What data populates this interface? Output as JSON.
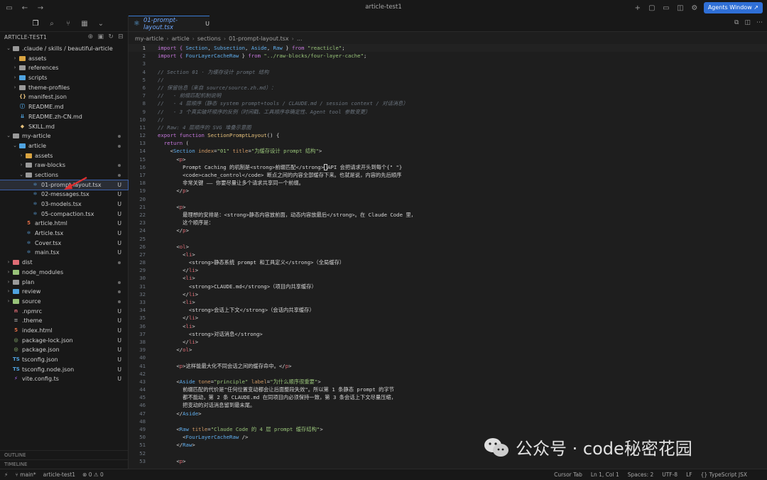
{
  "window": {
    "title": "article-test1",
    "agents_button": "Agents Window ↗"
  },
  "explorer": {
    "header": "ARTICLE-TEST1",
    "tree": [
      {
        "name": ".claude / skills / beautiful-article",
        "depth": 0,
        "type": "folder",
        "open": true,
        "icon": "folder",
        "color": "#9a9a9a",
        "badge": ""
      },
      {
        "name": "assets",
        "depth": 1,
        "type": "folder",
        "open": false,
        "icon": "folder",
        "color": "#d9a441",
        "badge": ""
      },
      {
        "name": "references",
        "depth": 1,
        "type": "folder",
        "open": false,
        "icon": "folder",
        "color": "#9a9a9a",
        "badge": ""
      },
      {
        "name": "scripts",
        "depth": 1,
        "type": "folder",
        "open": false,
        "icon": "folder",
        "color": "#4fa3e0",
        "badge": ""
      },
      {
        "name": "theme-profiles",
        "depth": 1,
        "type": "folder",
        "open": false,
        "icon": "folder",
        "color": "#9a9a9a",
        "badge": ""
      },
      {
        "name": "manifest.json",
        "depth": 1,
        "type": "file",
        "icon": "json",
        "color": "#e5c07b",
        "badge": ""
      },
      {
        "name": "README.md",
        "depth": 1,
        "type": "file",
        "icon": "info",
        "color": "#4fa3e0",
        "badge": ""
      },
      {
        "name": "README.zh-CN.md",
        "depth": 1,
        "type": "file",
        "icon": "md",
        "color": "#4fa3e0",
        "badge": ""
      },
      {
        "name": "SKILL.md",
        "depth": 1,
        "type": "file",
        "icon": "skill",
        "color": "#e5c07b",
        "badge": ""
      },
      {
        "name": "my-article",
        "depth": 0,
        "type": "folder",
        "open": true,
        "icon": "folder",
        "color": "#9a9a9a",
        "badge": "dot"
      },
      {
        "name": "article",
        "depth": 1,
        "type": "folder",
        "open": true,
        "icon": "folder",
        "color": "#4fa3e0",
        "badge": "dot"
      },
      {
        "name": "assets",
        "depth": 2,
        "type": "folder",
        "open": false,
        "icon": "folder",
        "color": "#d9a441",
        "badge": ""
      },
      {
        "name": "raw-blocks",
        "depth": 2,
        "type": "folder",
        "open": false,
        "icon": "folder",
        "color": "#9a9a9a",
        "badge": "dot"
      },
      {
        "name": "sections",
        "depth": 2,
        "type": "folder",
        "open": true,
        "icon": "folder",
        "color": "#9a9a9a",
        "badge": "dot"
      },
      {
        "name": "01-prompt-layout.tsx",
        "depth": 3,
        "type": "file",
        "icon": "react",
        "color": "#61afef",
        "badge": "U",
        "selected": true
      },
      {
        "name": "02-messages.tsx",
        "depth": 3,
        "type": "file",
        "icon": "react",
        "color": "#61afef",
        "badge": "U"
      },
      {
        "name": "03-models.tsx",
        "depth": 3,
        "type": "file",
        "icon": "react",
        "color": "#61afef",
        "badge": "U"
      },
      {
        "name": "05-compaction.tsx",
        "depth": 3,
        "type": "file",
        "icon": "react",
        "color": "#61afef",
        "badge": "U"
      },
      {
        "name": "article.html",
        "depth": 2,
        "type": "file",
        "icon": "html",
        "color": "#e06c45",
        "badge": "U"
      },
      {
        "name": "Article.tsx",
        "depth": 2,
        "type": "file",
        "icon": "react",
        "color": "#61afef",
        "badge": "U"
      },
      {
        "name": "Cover.tsx",
        "depth": 2,
        "type": "file",
        "icon": "react",
        "color": "#61afef",
        "badge": "U"
      },
      {
        "name": "main.tsx",
        "depth": 2,
        "type": "file",
        "icon": "react",
        "color": "#61afef",
        "badge": "U"
      },
      {
        "name": "dist",
        "depth": 0,
        "type": "folder",
        "open": false,
        "icon": "folder",
        "color": "#e06c75",
        "badge": "dot"
      },
      {
        "name": "node_modules",
        "depth": 0,
        "type": "folder",
        "open": false,
        "icon": "folder",
        "color": "#98c379",
        "badge": ""
      },
      {
        "name": "plan",
        "depth": 0,
        "type": "folder",
        "open": false,
        "icon": "folder",
        "color": "#9a9a9a",
        "badge": "dot"
      },
      {
        "name": "review",
        "depth": 0,
        "type": "folder",
        "open": false,
        "icon": "folder",
        "color": "#4fa3e0",
        "badge": "dot"
      },
      {
        "name": "source",
        "depth": 0,
        "type": "folder",
        "open": false,
        "icon": "folder",
        "color": "#98c379",
        "badge": "dot"
      },
      {
        "name": ".npmrc",
        "depth": 0,
        "type": "file",
        "icon": "npm",
        "color": "#e06c75",
        "badge": "U"
      },
      {
        "name": ".theme",
        "depth": 0,
        "type": "file",
        "icon": "lines",
        "color": "#9a9a9a",
        "badge": "U"
      },
      {
        "name": "index.html",
        "depth": 0,
        "type": "file",
        "icon": "html",
        "color": "#e06c45",
        "badge": "U"
      },
      {
        "name": "package-lock.json",
        "depth": 0,
        "type": "file",
        "icon": "pkg",
        "color": "#98c379",
        "badge": "U"
      },
      {
        "name": "package.json",
        "depth": 0,
        "type": "file",
        "icon": "pkg",
        "color": "#98c379",
        "badge": "U"
      },
      {
        "name": "tsconfig.json",
        "depth": 0,
        "type": "file",
        "icon": "ts",
        "color": "#4fa3e0",
        "badge": "U"
      },
      {
        "name": "tsconfig.node.json",
        "depth": 0,
        "type": "file",
        "icon": "ts",
        "color": "#4fa3e0",
        "badge": "U"
      },
      {
        "name": "vite.config.ts",
        "depth": 0,
        "type": "file",
        "icon": "vite",
        "color": "#b36bff",
        "badge": "U"
      }
    ],
    "outline_label": "OUTLINE",
    "timeline_label": "TIMELINE"
  },
  "editor": {
    "tab": {
      "name": "01-prompt-layout.tsx",
      "modified": "U"
    },
    "breadcrumb": [
      "my-article",
      "article",
      "sections",
      "01-prompt-layout.tsx",
      "..."
    ],
    "current_line": 1,
    "lines": [
      [
        [
          "import { ",
          "kw"
        ],
        [
          "Section",
          "comp"
        ],
        [
          ", ",
          "pl"
        ],
        [
          "Subsection",
          "comp"
        ],
        [
          ", ",
          "pl"
        ],
        [
          "Aside",
          "comp"
        ],
        [
          ", ",
          "pl"
        ],
        [
          "Raw",
          "comp"
        ],
        [
          " } ",
          "pl"
        ],
        [
          "from ",
          "kw"
        ],
        [
          "\"reacticle\"",
          "str"
        ],
        [
          ";",
          "pl"
        ]
      ],
      [
        [
          "import { ",
          "kw"
        ],
        [
          "FourLayerCacheRaw",
          "comp"
        ],
        [
          " } ",
          "pl"
        ],
        [
          "from ",
          "kw"
        ],
        [
          "\"../raw-blocks/four-layer-cache\"",
          "str"
        ],
        [
          ";",
          "pl"
        ]
      ],
      [],
      [
        [
          "// Section 01 · 为缓存设计 prompt 结构",
          "cm"
        ]
      ],
      [
        [
          "//",
          "cm"
        ]
      ],
      [
        [
          "// 保留信息（来自 source/source.zh.md）：",
          "cm"
        ]
      ],
      [
        [
          "//   - 前缀匹配机制说明",
          "cm"
        ]
      ],
      [
        [
          "//   - 4 层顺序（静态 system prompt+tools / CLAUDE.md / session context / 对话消息）",
          "cm"
        ]
      ],
      [
        [
          "//   - 3 个真实破坏顺序的反例（时间戳、工具顺序非确定性、Agent tool 参数变更）",
          "cm"
        ]
      ],
      [
        [
          "//",
          "cm"
        ]
      ],
      [
        [
          "// Raw: 4 层顺序的 SVG 堆叠示意图",
          "cm"
        ]
      ],
      [
        [
          "export function ",
          "kw"
        ],
        [
          "SectionPromptLayout",
          "fn"
        ],
        [
          "() {",
          "pl"
        ]
      ],
      [
        [
          "  return ",
          "kw"
        ],
        [
          "(",
          "pl"
        ]
      ],
      [
        [
          "    <",
          "pl"
        ],
        [
          "Section",
          "comp"
        ],
        [
          " index",
          "attr"
        ],
        [
          "=",
          "pl"
        ],
        [
          "\"01\"",
          "str"
        ],
        [
          " title",
          "attr"
        ],
        [
          "=",
          "pl"
        ],
        [
          "\"为缓存设计 prompt 结构\"",
          "str"
        ],
        [
          ">",
          "pl"
        ]
      ],
      [
        [
          "      <",
          "pl"
        ],
        [
          "p",
          "tag"
        ],
        [
          ">",
          "pl"
        ]
      ],
      [
        [
          "        Prompt Caching 的机制是<strong>前缀匹配</strong>",
          "pl"
        ],
        [
          "CURSOR",
          "cur"
        ],
        [
          "API 会把请求开头到每个{\" \"}",
          "pl"
        ]
      ],
      [
        [
          "        <code>cache_control</code> 断点之间的内容全部缓存下来。也就是说，内容的先后顺序",
          "pl"
        ]
      ],
      [
        [
          "        非常关键 —— 你要尽量让多个请求共享同一个前缀。",
          "pl"
        ]
      ],
      [
        [
          "      </",
          "pl"
        ],
        [
          "p",
          "tag"
        ],
        [
          ">",
          "pl"
        ]
      ],
      [],
      [
        [
          "      <",
          "pl"
        ],
        [
          "p",
          "tag"
        ],
        [
          ">",
          "pl"
        ]
      ],
      [
        [
          "        最理想的安排是：<strong>静态内容放前面，动态内容放最后</strong>。在 Claude Code 里，",
          "pl"
        ]
      ],
      [
        [
          "        这个顺序是：",
          "pl"
        ]
      ],
      [
        [
          "      </",
          "pl"
        ],
        [
          "p",
          "tag"
        ],
        [
          ">",
          "pl"
        ]
      ],
      [],
      [
        [
          "      <",
          "pl"
        ],
        [
          "ol",
          "tag"
        ],
        [
          ">",
          "pl"
        ]
      ],
      [
        [
          "        <",
          "pl"
        ],
        [
          "li",
          "tag"
        ],
        [
          ">",
          "pl"
        ]
      ],
      [
        [
          "          <strong>静态系统 prompt 和工具定义</strong>（全局缓存）",
          "pl"
        ]
      ],
      [
        [
          "        </",
          "pl"
        ],
        [
          "li",
          "tag"
        ],
        [
          ">",
          "pl"
        ]
      ],
      [
        [
          "        <",
          "pl"
        ],
        [
          "li",
          "tag"
        ],
        [
          ">",
          "pl"
        ]
      ],
      [
        [
          "          <strong>CLAUDE.md</strong>（项目内共享缓存）",
          "pl"
        ]
      ],
      [
        [
          "        </",
          "pl"
        ],
        [
          "li",
          "tag"
        ],
        [
          ">",
          "pl"
        ]
      ],
      [
        [
          "        <",
          "pl"
        ],
        [
          "li",
          "tag"
        ],
        [
          ">",
          "pl"
        ]
      ],
      [
        [
          "          <strong>会话上下文</strong>（会话内共享缓存）",
          "pl"
        ]
      ],
      [
        [
          "        </",
          "pl"
        ],
        [
          "li",
          "tag"
        ],
        [
          ">",
          "pl"
        ]
      ],
      [
        [
          "        <",
          "pl"
        ],
        [
          "li",
          "tag"
        ],
        [
          ">",
          "pl"
        ]
      ],
      [
        [
          "          <strong>对话消息</strong>",
          "pl"
        ]
      ],
      [
        [
          "        </",
          "pl"
        ],
        [
          "li",
          "tag"
        ],
        [
          ">",
          "pl"
        ]
      ],
      [
        [
          "      </",
          "pl"
        ],
        [
          "ol",
          "tag"
        ],
        [
          ">",
          "pl"
        ]
      ],
      [],
      [
        [
          "      <",
          "pl"
        ],
        [
          "p",
          "tag"
        ],
        [
          ">这样能最大化不同会话之间的缓存命中。</",
          "pl"
        ],
        [
          "p",
          "tag"
        ],
        [
          ">",
          "pl"
        ]
      ],
      [],
      [
        [
          "      <",
          "pl"
        ],
        [
          "Aside",
          "comp"
        ],
        [
          " tone",
          "attr"
        ],
        [
          "=",
          "pl"
        ],
        [
          "\"principle\"",
          "str"
        ],
        [
          " label",
          "attr"
        ],
        [
          "=",
          "pl"
        ],
        [
          "\"为什么顺序很重要\"",
          "str"
        ],
        [
          ">",
          "pl"
        ]
      ],
      [
        [
          "        前缀匹配的代价是\"任何位置变动都会让后面整段失效\"。所以第 1 条静态 prompt 的字节",
          "pl"
        ]
      ],
      [
        [
          "        都不能动，第 2 条 CLAUDE.md 在同项目内必须保持一致，第 3 条会话上下文尽量压缩，",
          "pl"
        ]
      ],
      [
        [
          "        把变动的对话消息留到最末尾。",
          "pl"
        ]
      ],
      [
        [
          "      </",
          "pl"
        ],
        [
          "Aside",
          "comp"
        ],
        [
          ">",
          "pl"
        ]
      ],
      [],
      [
        [
          "      <",
          "pl"
        ],
        [
          "Raw",
          "comp"
        ],
        [
          " title",
          "attr"
        ],
        [
          "=",
          "pl"
        ],
        [
          "\"Claude Code 的 4 层 prompt 缓存结构\"",
          "str"
        ],
        [
          ">",
          "pl"
        ]
      ],
      [
        [
          "        <",
          "pl"
        ],
        [
          "FourLayerCacheRaw",
          "comp"
        ],
        [
          " />",
          "pl"
        ]
      ],
      [
        [
          "      </",
          "pl"
        ],
        [
          "Raw",
          "comp"
        ],
        [
          ">",
          "pl"
        ]
      ],
      [],
      [
        [
          "      <",
          "pl"
        ],
        [
          "p",
          "tag"
        ],
        [
          ">",
          "pl"
        ]
      ]
    ]
  },
  "statusbar": {
    "branch": "main*",
    "project": "article-test1",
    "problems": "⊗ 0  ⚠ 0",
    "items": [
      "Cursor Tab",
      "Ln 1, Col 1",
      "Spaces: 2",
      "UTF-8",
      "LF",
      "{} TypeScript JSX"
    ]
  },
  "watermark": {
    "text": "公众号 · code秘密花园"
  }
}
